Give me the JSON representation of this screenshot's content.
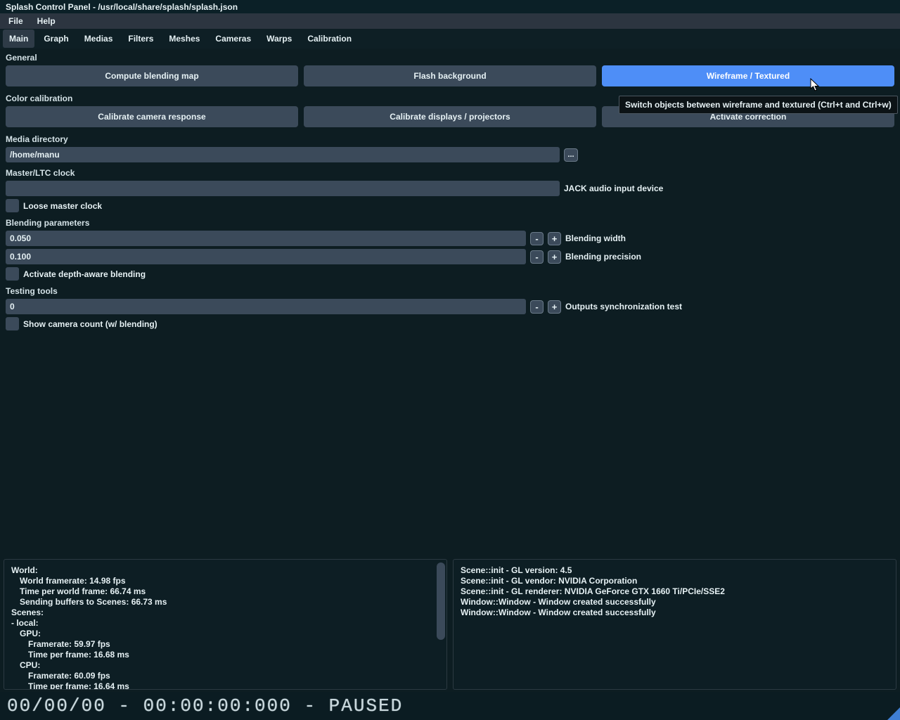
{
  "title": "Splash Control Panel - /usr/local/share/splash/splash.json",
  "menubar": {
    "file": "File",
    "help": "Help"
  },
  "tabs": {
    "main": "Main",
    "graph": "Graph",
    "medias": "Medias",
    "filters": "Filters",
    "meshes": "Meshes",
    "cameras": "Cameras",
    "warps": "Warps",
    "calibration": "Calibration"
  },
  "sections": {
    "general": "General",
    "color_calibration": "Color calibration",
    "media_directory": "Media directory",
    "master_clock": "Master/LTC clock",
    "blending": "Blending parameters",
    "testing": "Testing tools"
  },
  "buttons": {
    "compute_blending": "Compute blending map",
    "flash_background": "Flash background",
    "wireframe_textured": "Wireframe / Textured",
    "calibrate_camera": "Calibrate camera response",
    "calibrate_displays": "Calibrate displays / projectors",
    "activate_correction": "Activate correction",
    "browse": "...",
    "minus": "-",
    "plus": "+"
  },
  "fields": {
    "media_dir_value": "/home/manu",
    "jack_label": "JACK audio input device",
    "loose_master": "Loose master clock",
    "blending_width_value": "0.050",
    "blending_width_label": "Blending width",
    "blending_precision_value": "0.100",
    "blending_precision_label": "Blending precision",
    "depth_aware": "Activate depth-aware blending",
    "sync_test_value": "0",
    "sync_test_label": "Outputs synchronization test",
    "show_camera_count": "Show camera count (w/ blending)"
  },
  "tooltip": "Switch objects between wireframe and textured (Ctrl+t and Ctrl+w)",
  "logs": {
    "left": [
      "World:",
      "World framerate: 14.98 fps",
      "Time per world frame: 66.74 ms",
      "Sending buffers to Scenes: 66.73 ms",
      "Scenes:",
      "- local:",
      "GPU:",
      "Framerate: 59.97 fps",
      "Time per frame: 16.68 ms",
      "CPU:",
      "Framerate: 60.09 fps",
      "Time per frame: 16.64 ms"
    ],
    "right": [
      "Scene::init - GL version: 4.5",
      "Scene::init - GL vendor: NVIDIA Corporation",
      "Scene::init - GL renderer: NVIDIA GeForce GTX 1660 Ti/PCIe/SSE2",
      "Window::Window - Window created successfully",
      "Window::Window - Window created successfully"
    ]
  },
  "status": "00/00/00 - 00:00:00:000 - PAUSED"
}
